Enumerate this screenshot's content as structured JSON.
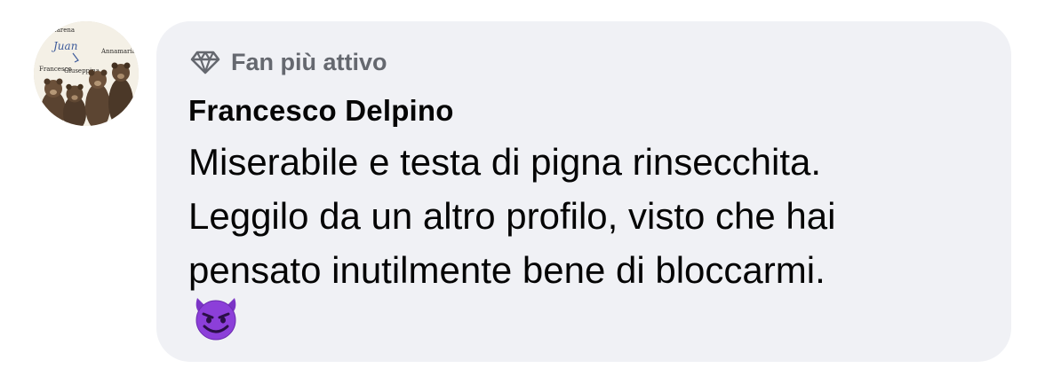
{
  "avatar": {
    "caption_top": "Amarena",
    "caption_script": "Juan",
    "caption_left": "Francesco",
    "caption_mid": "Giuseppina",
    "caption_right": "Annamaria"
  },
  "comment": {
    "badge_label": "Fan più attivo",
    "badge_icon": "diamond-icon",
    "author": "Francesco Delpino",
    "message_lines": [
      "Miserabile e testa di pigna rinsecchita.",
      "Leggilo da un altro profilo, visto che hai",
      "pensato inutilmente bene di bloccarmi."
    ],
    "emoji": "smiling-imp-emoji"
  },
  "colors": {
    "bubble": "#f0f1f5",
    "badge_text": "#65686f",
    "text": "#050505",
    "emoji": "#8c3fd9"
  }
}
